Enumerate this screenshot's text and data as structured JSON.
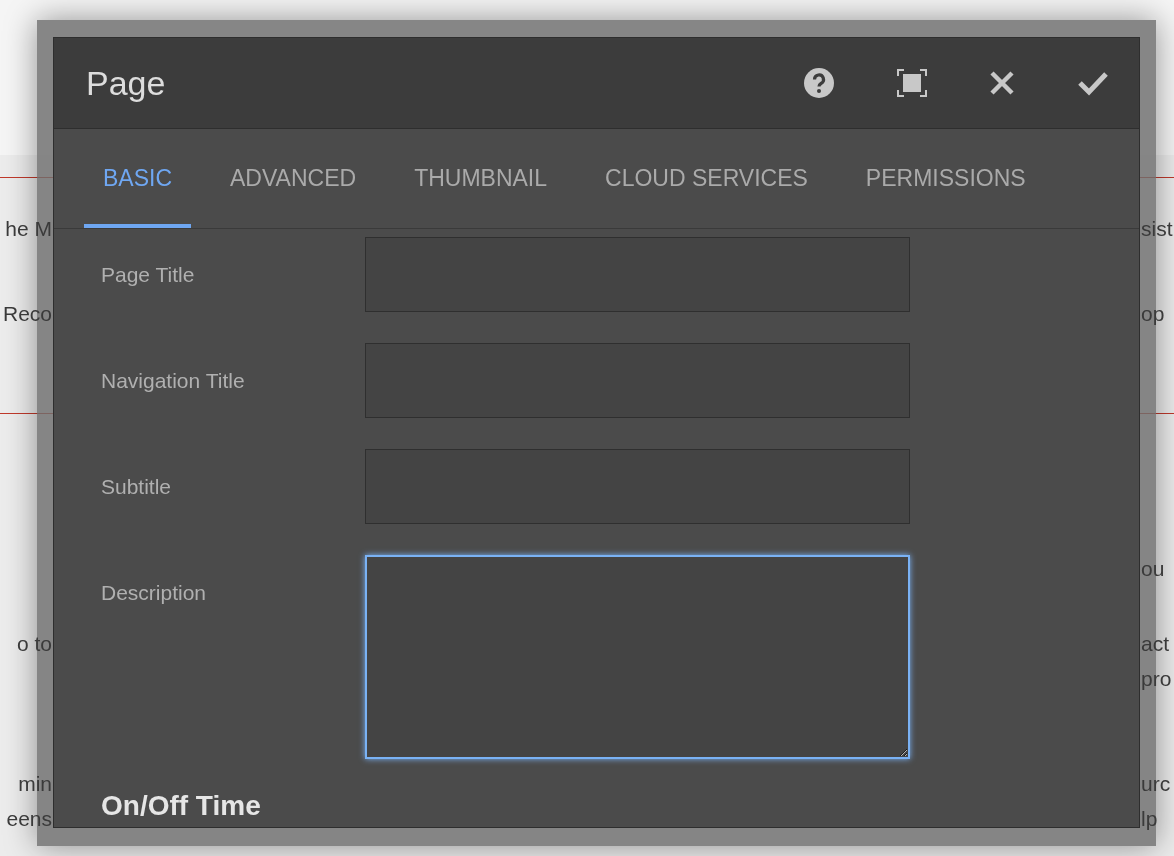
{
  "background": {
    "left_fragments": [
      "he M",
      "Reco",
      "o to",
      "min",
      "eens"
    ],
    "right_fragments": [
      "sist",
      "op",
      "ou",
      "act",
      "pro",
      "urc",
      "lp"
    ]
  },
  "dialog": {
    "title": "Page",
    "tabs": [
      {
        "label": "BASIC",
        "selected": true
      },
      {
        "label": "ADVANCED",
        "selected": false
      },
      {
        "label": "THUMBNAIL",
        "selected": false
      },
      {
        "label": "CLOUD SERVICES",
        "selected": false
      },
      {
        "label": "PERMISSIONS",
        "selected": false
      }
    ],
    "fields": [
      {
        "label": "Page Title",
        "kind": "input",
        "focused": false
      },
      {
        "label": "Navigation Title",
        "kind": "input",
        "focused": false
      },
      {
        "label": "Subtitle",
        "kind": "input",
        "focused": false
      },
      {
        "label": "Description",
        "kind": "textarea",
        "focused": true
      }
    ],
    "section_heading": "On/Off Time"
  }
}
